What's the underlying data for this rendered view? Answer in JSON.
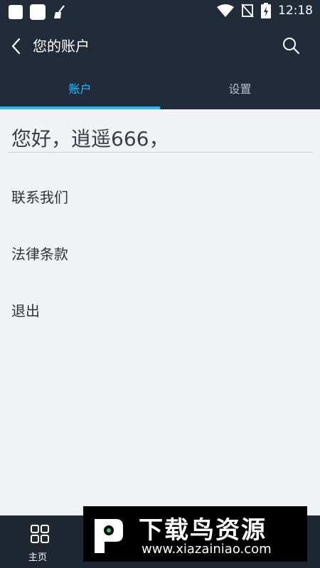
{
  "status_bar": {
    "time": "12:18",
    "icons": [
      "notification-square-icon",
      "notification-square-icon",
      "broom-icon",
      "wifi-icon",
      "no-sim-icon",
      "battery-charging-icon"
    ]
  },
  "header": {
    "title": "您的账户",
    "back_icon": "chevron-left-icon",
    "search_icon": "search-icon"
  },
  "tabs": [
    {
      "label": "账户",
      "active": true
    },
    {
      "label": "设置",
      "active": false
    }
  ],
  "colors": {
    "header_bg": "#222b3a",
    "accent": "#29b6f6",
    "page_bg": "#f0f2f5"
  },
  "greeting": "您好，逍遥666，",
  "menu": [
    {
      "label": "联系我们"
    },
    {
      "label": "法律条款"
    },
    {
      "label": "退出"
    }
  ],
  "bottom_nav": {
    "home_label": "主页",
    "home_icon": "grid-icon"
  },
  "watermark": {
    "title": "下载鸟资源",
    "url": "www.xiazainiao.com"
  }
}
